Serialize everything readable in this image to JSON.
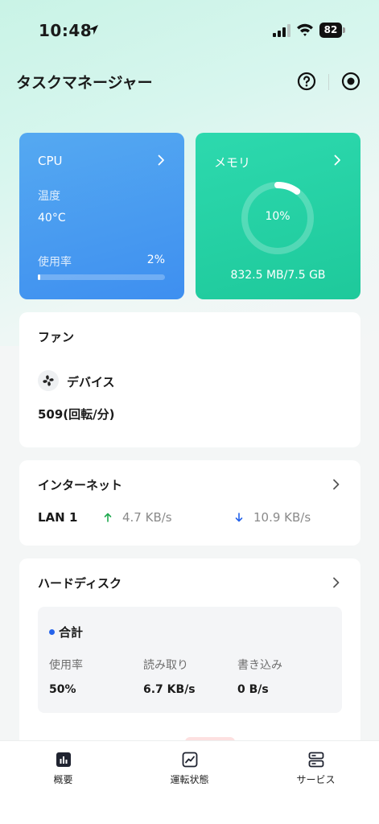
{
  "status_bar": {
    "time": "10:48",
    "battery": "82"
  },
  "header": {
    "title": "タスクマネージャー"
  },
  "cpu": {
    "title": "CPU",
    "temp_label": "温度",
    "temp_value": "40°C",
    "usage_label": "使用率",
    "usage_value": "2%",
    "usage_fraction": 0.02
  },
  "memory": {
    "title": "メモリ",
    "percent_label": "10%",
    "percent_fraction": 0.1,
    "detail": "832.5 MB/7.5 GB"
  },
  "fan": {
    "title": "ファン",
    "device_label": "デバイス",
    "speed": "509(回転/分)"
  },
  "internet": {
    "title": "インターネット",
    "lan_name": "LAN 1",
    "upload": "4.7 KB/s",
    "download": "10.9 KB/s"
  },
  "disk": {
    "title": "ハードディスク",
    "summary_label": "合計",
    "columns": [
      {
        "label": "使用率",
        "value": "50%"
      },
      {
        "label": "読み取り",
        "value": "6.7 KB/s"
      },
      {
        "label": "書き込み",
        "value": "0 B/s"
      }
    ]
  },
  "tabs": [
    {
      "label": "概要",
      "icon": "bar-chart-icon"
    },
    {
      "label": "運転状態",
      "icon": "line-chart-icon"
    },
    {
      "label": "サービス",
      "icon": "server-icon"
    }
  ],
  "colors": {
    "cpu_card": "#3e8ff0",
    "memory_card": "#1ec99b",
    "upload_arrow": "#1faa4f",
    "download_arrow": "#2563eb"
  }
}
